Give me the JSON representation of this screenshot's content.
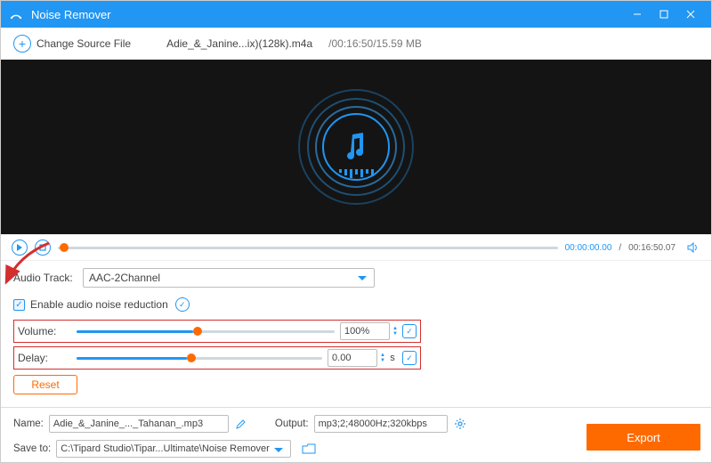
{
  "titlebar": {
    "title": "Noise Remover"
  },
  "toolbar": {
    "change_source_label": "Change Source File",
    "filename": "Adie_&_Janine...ix)(128k).m4a",
    "file_info": "/00:16:50/15.59 MB"
  },
  "playback": {
    "time_current": "00:00:00.00",
    "time_total": "00:16:50.07"
  },
  "controls": {
    "audio_track_label": "Audio Track:",
    "audio_track_value": "AAC-2Channel",
    "enable_noise_label": "Enable audio noise reduction",
    "enable_noise_checked": true,
    "volume_label": "Volume:",
    "volume_value": "100%",
    "volume_percent": 45,
    "delay_label": "Delay:",
    "delay_value": "0.00",
    "delay_percent": 45,
    "delay_unit": "s",
    "reset_label": "Reset"
  },
  "bottom": {
    "name_label": "Name:",
    "name_value": "Adie_&_Janine_..._Tahanan_.mp3",
    "output_label": "Output:",
    "output_value": "mp3;2;48000Hz;320kbps",
    "saveto_label": "Save to:",
    "saveto_value": "C:\\Tipard Studio\\Tipar...Ultimate\\Noise Remover",
    "export_label": "Export"
  }
}
